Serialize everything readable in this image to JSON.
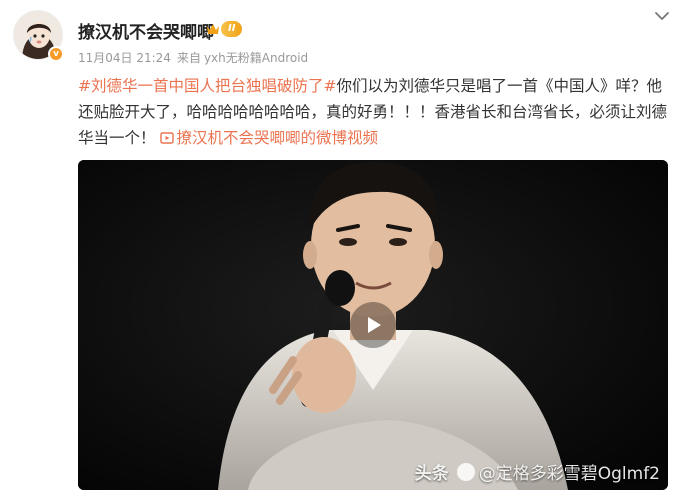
{
  "post": {
    "username": "撩汉机不会哭唧唧",
    "level": "II",
    "timestamp": "11月04日 21:24",
    "source_prefix": "来自",
    "source": "yxh无粉籍Android",
    "hashtag": "#刘德华一首中国人把台独唱破防了#",
    "body": "你们以为刘德华只是唱了一首《中国人》咩？他还贴脸开大了，哈哈哈哈哈哈哈哈，真的好勇！！！香港省长和台湾省长，必须让刘德华当一个！",
    "video_link": "撩汉机不会哭唧唧的微博视频"
  },
  "video": {
    "watermark_source": "头条",
    "watermark_text": "@定格多彩雪碧Oglmf2"
  },
  "colors": {
    "accent": "#eb7350",
    "badge": "#f2a218",
    "verified": "#f79a27"
  },
  "icons": {
    "more": "chevron-down-icon",
    "play": "play-icon",
    "crown": "crown-icon",
    "link": "video-link-icon"
  }
}
